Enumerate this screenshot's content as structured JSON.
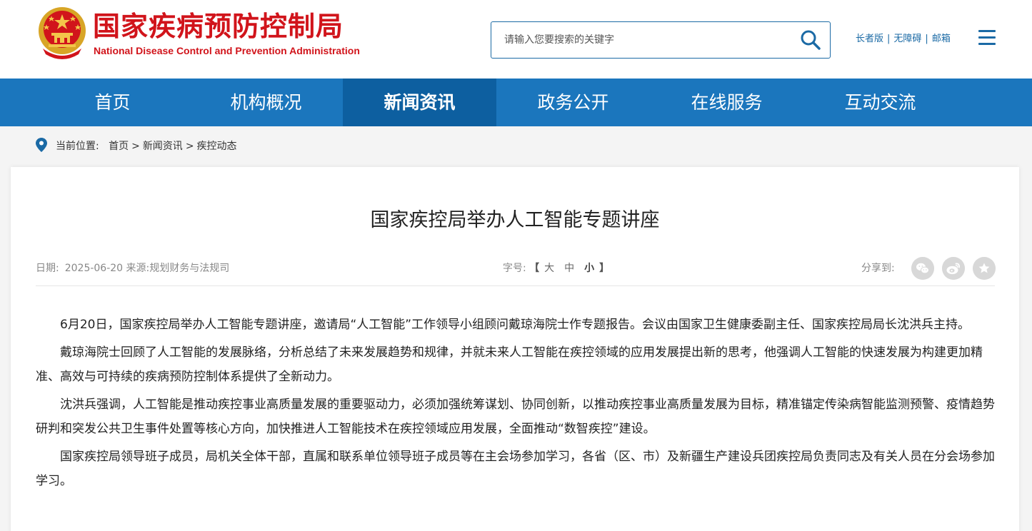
{
  "header": {
    "org_name_cn": "国家疾病预防控制局",
    "org_name_en": "National Disease Control and Prevention Administration",
    "search_placeholder": "请输入您要搜索的关键字",
    "links": [
      "长者版",
      "无障碍",
      "邮箱"
    ]
  },
  "nav": {
    "items": [
      "首页",
      "机构概况",
      "新闻资讯",
      "政务公开",
      "在线服务",
      "互动交流"
    ],
    "active": "新闻资讯"
  },
  "breadcrumb": {
    "label": "当前位置:",
    "items": [
      "首页",
      "新闻资讯",
      "疾控动态"
    ],
    "separator": ">"
  },
  "article": {
    "title": "国家疾控局举办人工智能专题讲座",
    "date_label": "日期:",
    "date": "2025-06-20",
    "source_label": "来源:",
    "source": "规划财务与法规司",
    "font_label": "字号:",
    "font_sizes": [
      "大",
      "中",
      "小"
    ],
    "share_label": "分享到:",
    "paragraphs": [
      "6月20日，国家疾控局举办人工智能专题讲座，邀请局“人工智能”工作领导小组顾问戴琼海院士作专题报告。会议由国家卫生健康委副主任、国家疾控局局长沈洪兵主持。",
      "戴琼海院士回顾了人工智能的发展脉络，分析总结了未来发展趋势和规律，并就未来人工智能在疾控领域的应用发展提出新的思考，他强调人工智能的快速发展为构建更加精准、高效与可持续的疾病预防控制体系提供了全新动力。",
      "沈洪兵强调，人工智能是推动疾控事业高质量发展的重要驱动力，必须加强统筹谋划、协同创新，以推动疾控事业高质量发展为目标，精准锚定传染病智能监测预警、疫情趋势研判和突发公共卫生事件处置等核心方向，加快推进人工智能技术在疾控领域应用发展，全面推动“数智疾控”建设。",
      "国家疾控局领导班子成员，局机关全体干部，直属和联系单位领导班子成员等在主会场参加学习，各省（区、市）及新疆生产建设兵团疾控局负责同志及有关人员在分会场参加学习。"
    ]
  },
  "colors": {
    "brand_red": "#d1141b",
    "nav_blue": "#1b76bd",
    "nav_active": "#0d5fa0",
    "link_blue": "#1b6aa5"
  },
  "icons": [
    "national-emblem-icon",
    "search-icon",
    "menu-icon",
    "location-pin-icon",
    "wechat-icon",
    "weibo-icon",
    "favorite-star-icon"
  ]
}
